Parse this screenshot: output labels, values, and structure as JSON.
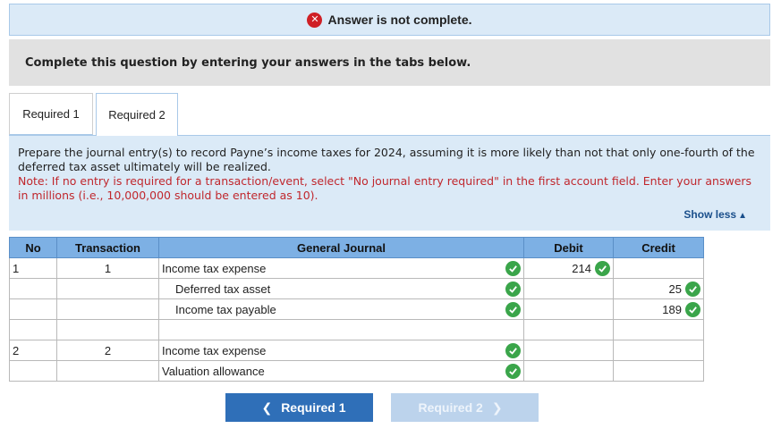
{
  "banner": {
    "text": "Answer is not complete."
  },
  "instructions": "Complete this question by entering your answers in the tabs below.",
  "tabs": [
    {
      "label": "Required 1"
    },
    {
      "label": "Required 2"
    }
  ],
  "panel": {
    "prompt": "Prepare the journal entry(s) to record Payne’s income taxes for 2024, assuming it is more likely than not that only one-fourth of the deferred tax asset ultimately will be realized.",
    "note": "Note: If no entry is required for a transaction/event, select \"No journal entry required\" in the first account field. Enter your answers in millions (i.e., 10,000,000 should be entered as 10).",
    "show_less": "Show less"
  },
  "journal": {
    "headers": {
      "no": "No",
      "transaction": "Transaction",
      "general_journal": "General Journal",
      "debit": "Debit",
      "credit": "Credit"
    },
    "rows": [
      {
        "no": "1",
        "transaction": "1",
        "account": "Income tax expense",
        "debit": "214",
        "credit": ""
      },
      {
        "no": "",
        "transaction": "",
        "account": "Deferred tax asset",
        "debit": "",
        "credit": "25"
      },
      {
        "no": "",
        "transaction": "",
        "account": "Income tax payable",
        "debit": "",
        "credit": "189"
      },
      {
        "no": "",
        "transaction": "",
        "account": "",
        "debit": "",
        "credit": ""
      },
      {
        "no": "2",
        "transaction": "2",
        "account": "Income tax expense",
        "debit": "",
        "credit": ""
      },
      {
        "no": "",
        "transaction": "",
        "account": "Valuation allowance",
        "debit": "",
        "credit": ""
      }
    ]
  },
  "nav": {
    "prev_label": "Required 1",
    "next_label": "Required 2"
  },
  "colors": {
    "check": "#3aa54a",
    "error": "#cf2026",
    "header": "#7db0e4",
    "note": "#c0272d",
    "primary_button": "#2f6fb8"
  }
}
